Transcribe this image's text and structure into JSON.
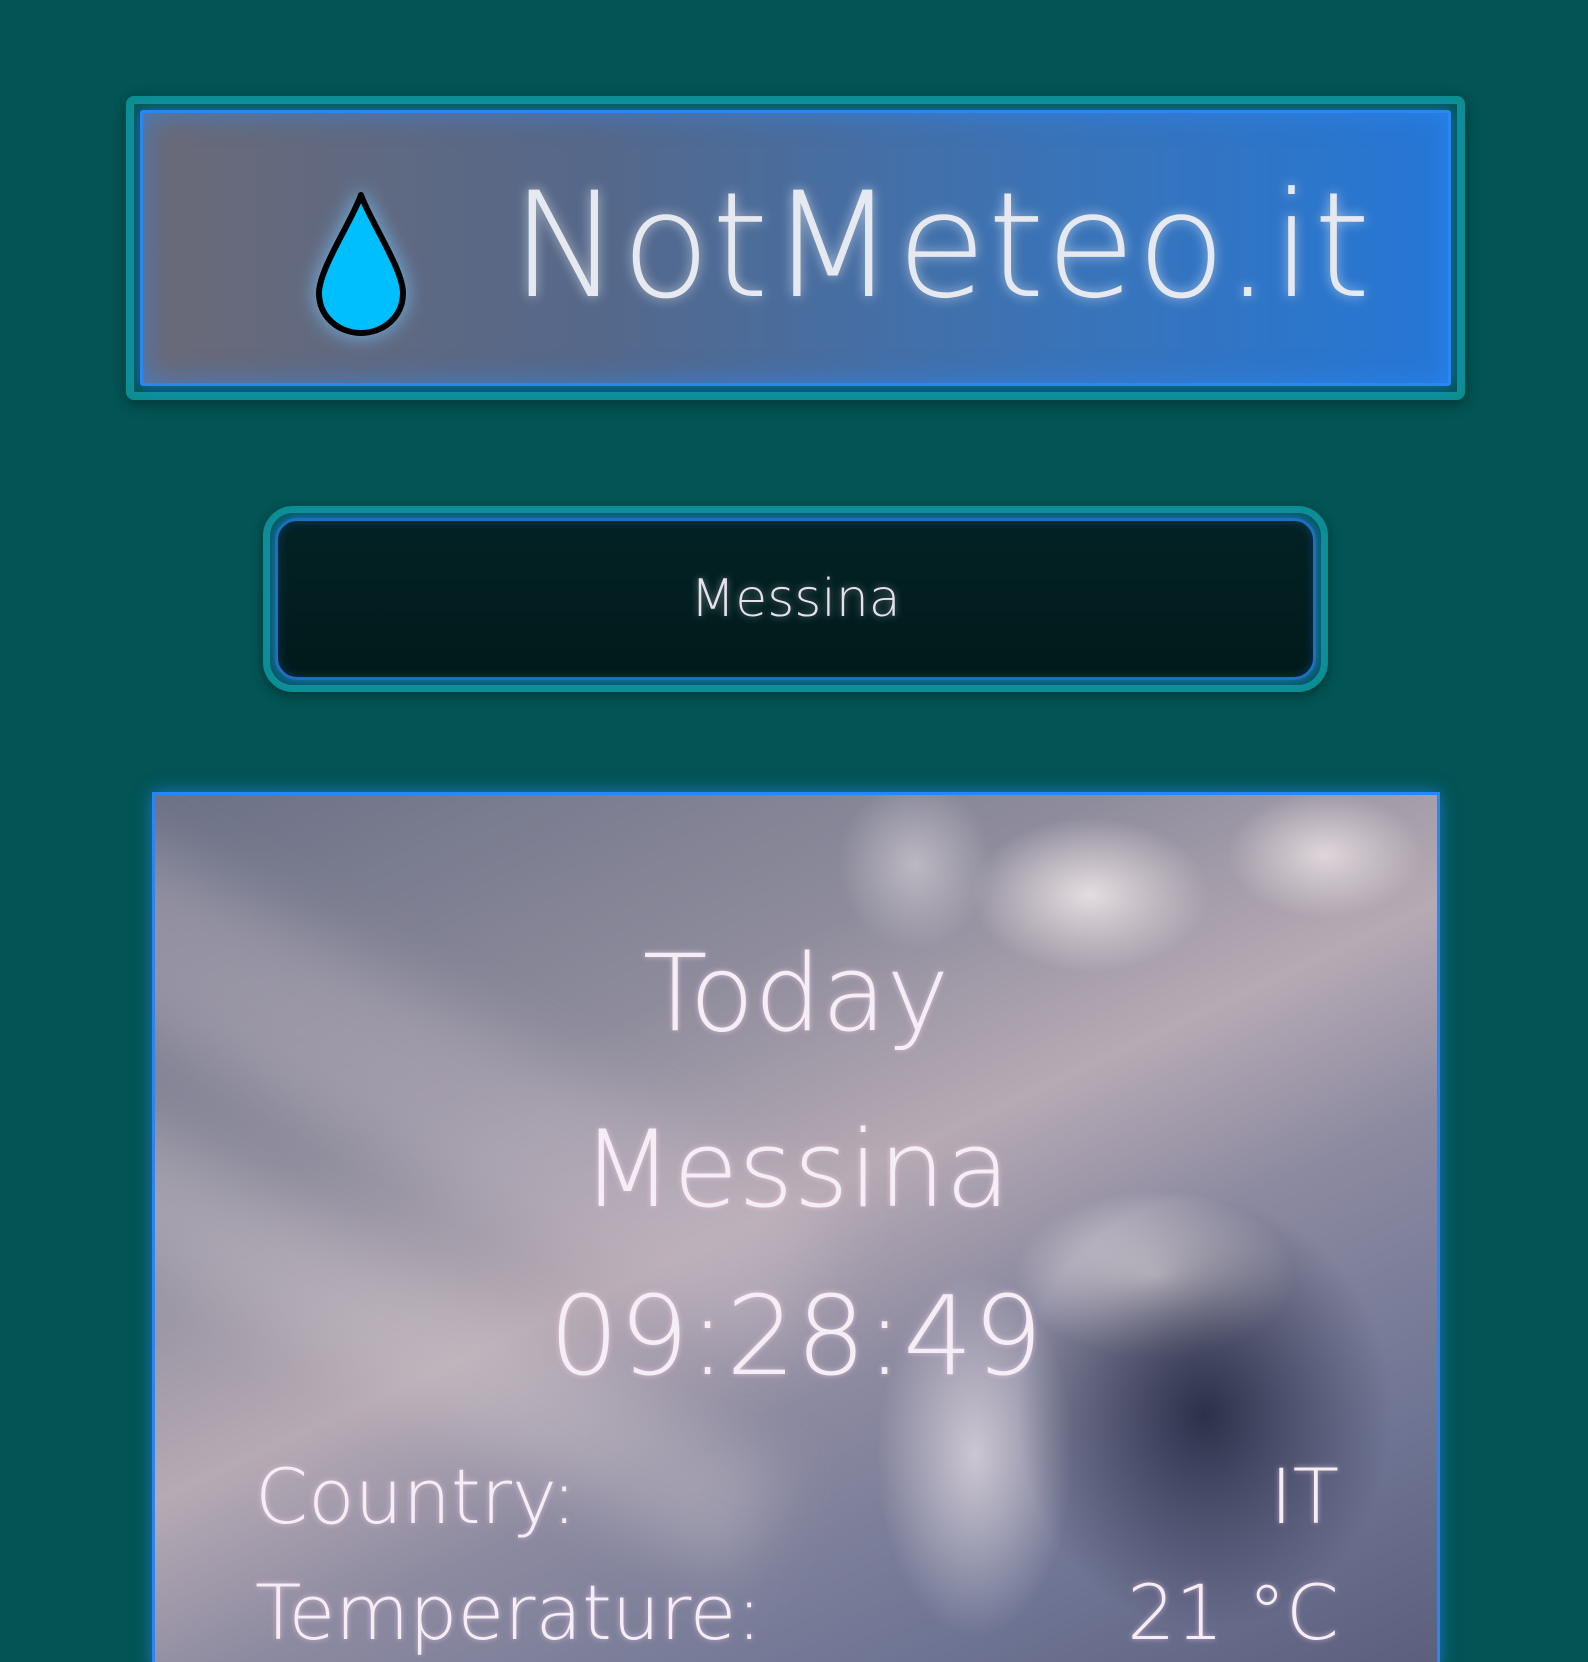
{
  "header": {
    "brand": "NotMeteo.it",
    "icon": "water-drop-icon",
    "icon_color": "#00bfff"
  },
  "search": {
    "value": "Messina"
  },
  "weather": {
    "day": "Today",
    "city": "Messina",
    "time": "09:28:49",
    "rows": [
      {
        "label": "Country:",
        "value": "IT"
      },
      {
        "label": "Temperature:",
        "value": "21 °C"
      }
    ]
  },
  "colors": {
    "background": "#035454",
    "accent_border": "#0c8f91",
    "glow_blue": "#2b86f2"
  }
}
